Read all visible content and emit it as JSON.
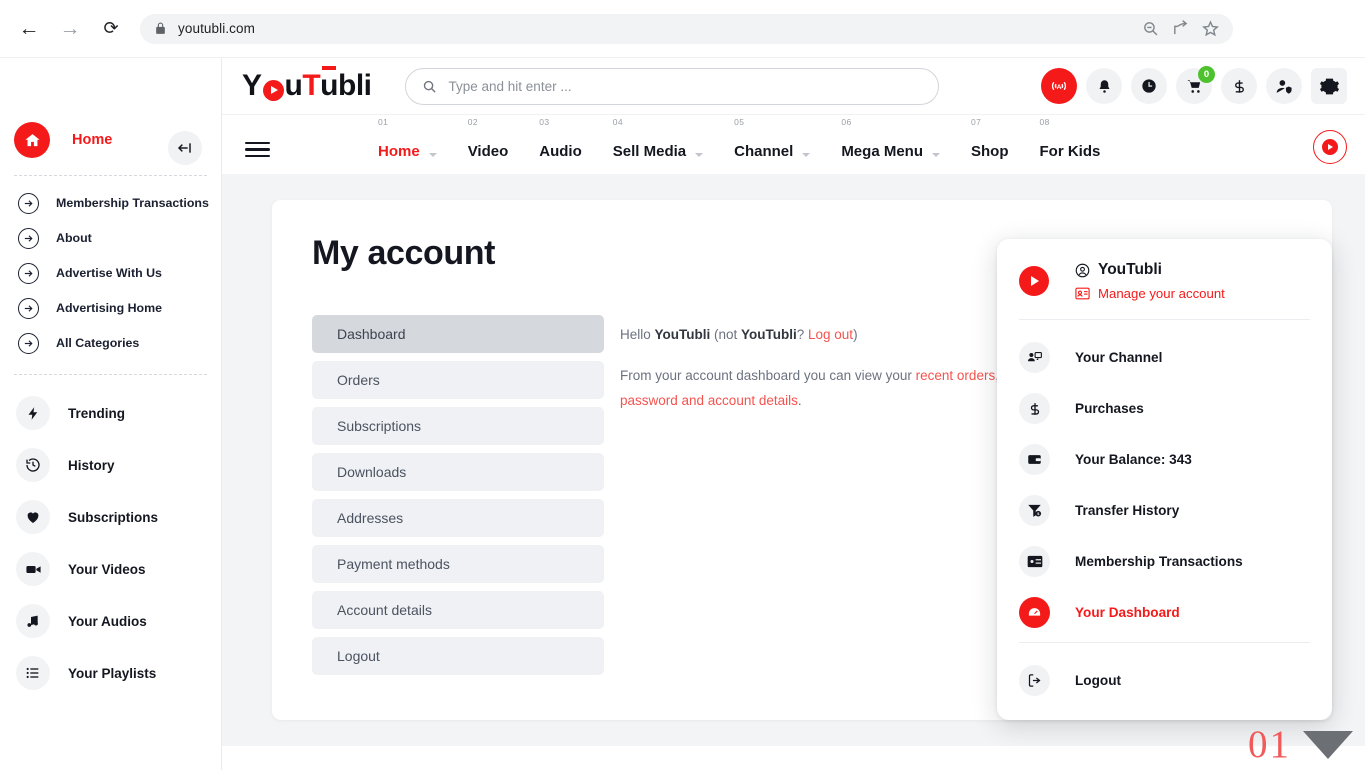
{
  "browser": {
    "back_icon": "arrow-left-icon",
    "forward_icon": "arrow-right-icon",
    "reload_icon": "reload-icon",
    "lock_icon": "lock-icon",
    "url": "youtubli.com",
    "actions": [
      "zoom-search-icon",
      "share-icon",
      "bookmark-star-icon"
    ]
  },
  "sidebar": {
    "collapse_icon": "collapse-sidebar-icon",
    "home": {
      "label": "Home",
      "icon": "home-icon"
    },
    "links": [
      {
        "label": "Membership Transactions",
        "icon": "arrow-circle-right-icon"
      },
      {
        "label": "About",
        "icon": "arrow-circle-right-icon"
      },
      {
        "label": "Advertise With Us",
        "icon": "arrow-circle-right-icon"
      },
      {
        "label": "Advertising Home",
        "icon": "arrow-circle-right-icon"
      },
      {
        "label": "All Categories",
        "icon": "arrow-circle-right-icon"
      }
    ],
    "main": [
      {
        "label": "Trending",
        "icon": "lightning-bolt-icon"
      },
      {
        "label": "History",
        "icon": "history-clock-icon"
      },
      {
        "label": "Subscriptions",
        "icon": "heart-icon"
      },
      {
        "label": "Your Videos",
        "icon": "video-camera-icon"
      },
      {
        "label": "Your Audios",
        "icon": "music-note-icon"
      },
      {
        "label": "Your Playlists",
        "icon": "list-icon"
      }
    ]
  },
  "header": {
    "logo": {
      "part1": "Y",
      "part2": "u",
      "part3": "T",
      "part4": "u",
      "part5": "bli",
      "alt": "YouTubli"
    },
    "search": {
      "placeholder": "Type and hit enter ...",
      "value": "",
      "icon": "search-icon"
    },
    "icons": [
      {
        "name": "live-broadcast-icon",
        "badge": ""
      },
      {
        "name": "bell-notification-icon",
        "badge": ""
      },
      {
        "name": "clock-icon",
        "badge": ""
      },
      {
        "name": "shopping-cart-icon",
        "badge": "0"
      },
      {
        "name": "dollar-icon",
        "badge": ""
      },
      {
        "name": "user-shield-icon",
        "badge": ""
      },
      {
        "name": "gear-settings-icon",
        "badge": ""
      }
    ]
  },
  "nav": {
    "menu_icon": "hamburger-menu-icon",
    "items": [
      {
        "num": "01",
        "label": "Home",
        "caret": true,
        "active": true
      },
      {
        "num": "02",
        "label": "Video",
        "caret": false,
        "active": false
      },
      {
        "num": "03",
        "label": "Audio",
        "caret": false,
        "active": false
      },
      {
        "num": "04",
        "label": "Sell Media",
        "caret": true,
        "active": false
      },
      {
        "num": "05",
        "label": "Channel",
        "caret": true,
        "active": false
      },
      {
        "num": "06",
        "label": "Mega Menu",
        "caret": true,
        "active": false
      },
      {
        "num": "07",
        "label": "Shop",
        "caret": false,
        "active": false
      },
      {
        "num": "08",
        "label": "For Kids",
        "caret": false,
        "active": false
      }
    ],
    "live_button_icon": "live-play-ring-icon"
  },
  "main": {
    "title": "My account",
    "menu": [
      {
        "label": "Dashboard",
        "active": true
      },
      {
        "label": "Orders",
        "active": false
      },
      {
        "label": "Subscriptions",
        "active": false
      },
      {
        "label": "Downloads",
        "active": false
      },
      {
        "label": "Addresses",
        "active": false
      },
      {
        "label": "Payment methods",
        "active": false
      },
      {
        "label": "Account details",
        "active": false
      },
      {
        "label": "Logout",
        "active": false
      }
    ],
    "greeting": {
      "hello": "Hello ",
      "user": "YouTubli",
      "not_open": " (not ",
      "user2": "YouTubli",
      "q": "? ",
      "logout_link": "Log out",
      "close": ")"
    },
    "dashboard_text": {
      "p1": "From your account dashboard you can view your ",
      "link1": "recent orders",
      "p2": ", manag",
      "link2": "password and account details",
      "p3": "."
    }
  },
  "dropdown": {
    "avatar_icon": "play-avatar-icon",
    "account_icon": "user-circle-icon",
    "name": "YouTubli",
    "manage_icon": "id-card-icon",
    "manage_label": "Manage your account",
    "items": [
      {
        "label": "Your Channel",
        "icon": "channel-icon",
        "active": false
      },
      {
        "label": "Purchases",
        "icon": "dollar-icon",
        "active": false
      },
      {
        "label": "Your Balance: 343",
        "icon": "wallet-icon",
        "active": false
      },
      {
        "label": "Transfer History",
        "icon": "transfer-funnel-icon",
        "active": false
      },
      {
        "label": "Membership Transactions",
        "icon": "membership-card-icon",
        "active": false
      },
      {
        "label": "Your Dashboard",
        "icon": "dashboard-gauge-icon",
        "active": true
      }
    ],
    "logout": {
      "label": "Logout",
      "icon": "logout-icon"
    }
  },
  "corner": {
    "number": "01",
    "arrow_icon": "triangle-down-icon"
  },
  "colors": {
    "brand_red": "#f51a1a",
    "link_red": "#f5534e",
    "badge_green": "#4ec22e",
    "panel_bg": "#f3f4f6"
  }
}
